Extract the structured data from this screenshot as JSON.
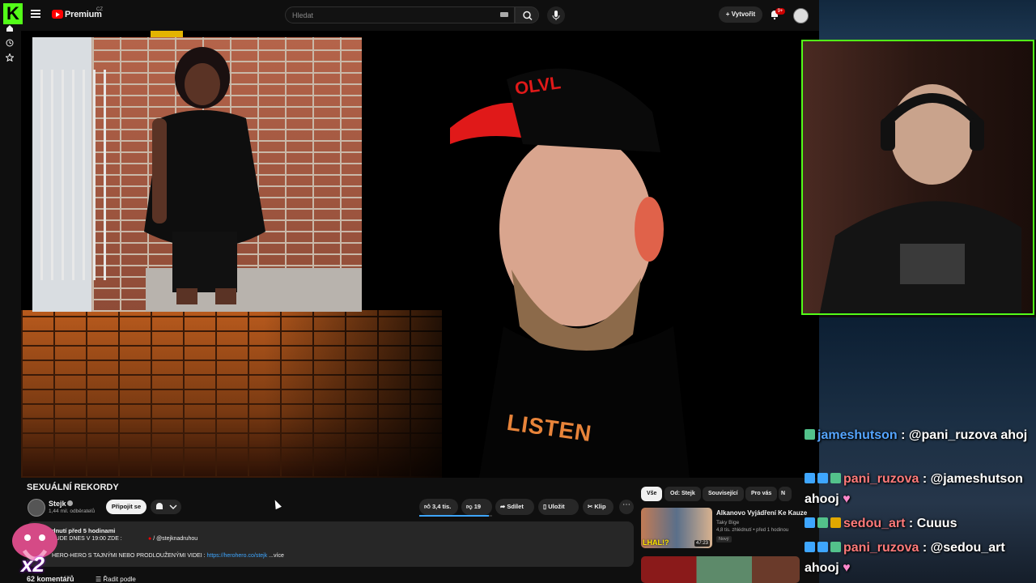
{
  "header": {
    "brand": "Premium",
    "region": "CZ",
    "search_placeholder": "Hledat",
    "create_label": "Vytvořit",
    "notif_count": "9+"
  },
  "video": {
    "title": "SEXUÁLNÍ REKORDY",
    "shirt_text": "LISTEN",
    "cap_text": "OLVL"
  },
  "channel": {
    "name": "Stejk",
    "subscribers": "1,44 mil. odběratelů",
    "join_label": "Připojit se"
  },
  "actions": {
    "likes": "3,4 tis.",
    "dislikes": "19",
    "share": "Sdílet",
    "save": "Uložit",
    "clip": "Klip",
    "more": "⋯",
    "like_ratio": 0.95
  },
  "description": {
    "line1": "dnutí  před 5 hodinami",
    "line2_prefix": "BUDE DNES V 19:00 ZDE :",
    "line2_handle": "/ @stejknadruhou",
    "line3_prefix": "HERO-HERO S TAJNÝMI NEBO PRODLOUŽENÝMI VIDEI :",
    "line3_link": "https://herohero.co/stejk",
    "line3_more": "...více"
  },
  "comments": {
    "count": "62 komentářů",
    "sort": "Řadit podle"
  },
  "chips": [
    "Vše",
    "Od: Stejk",
    "Související",
    "Pro vás",
    "N"
  ],
  "related": [
    {
      "title": "Alkanovo Vyjádření Ke Kauze",
      "channel": "Taky Bige",
      "meta": "4,8 tis. zhlédnutí • před 1 hodinou",
      "badge": "Nový",
      "duration": "47:23",
      "thumb_text": "LHAL!?"
    }
  ],
  "overlay": {
    "multiplier": "x2"
  },
  "chat": [
    {
      "user": "jameshutson",
      "message": ": @pani_ruzova ahoj"
    },
    {
      "user": "pani_ruzova",
      "message": ": @jameshutson",
      "cont": "ahooj"
    },
    {
      "user": "sedou_art",
      "message": ": Cuuus"
    },
    {
      "user": "pani_ruzova",
      "message": ": @sedou_art",
      "cont": "ahooj"
    }
  ]
}
